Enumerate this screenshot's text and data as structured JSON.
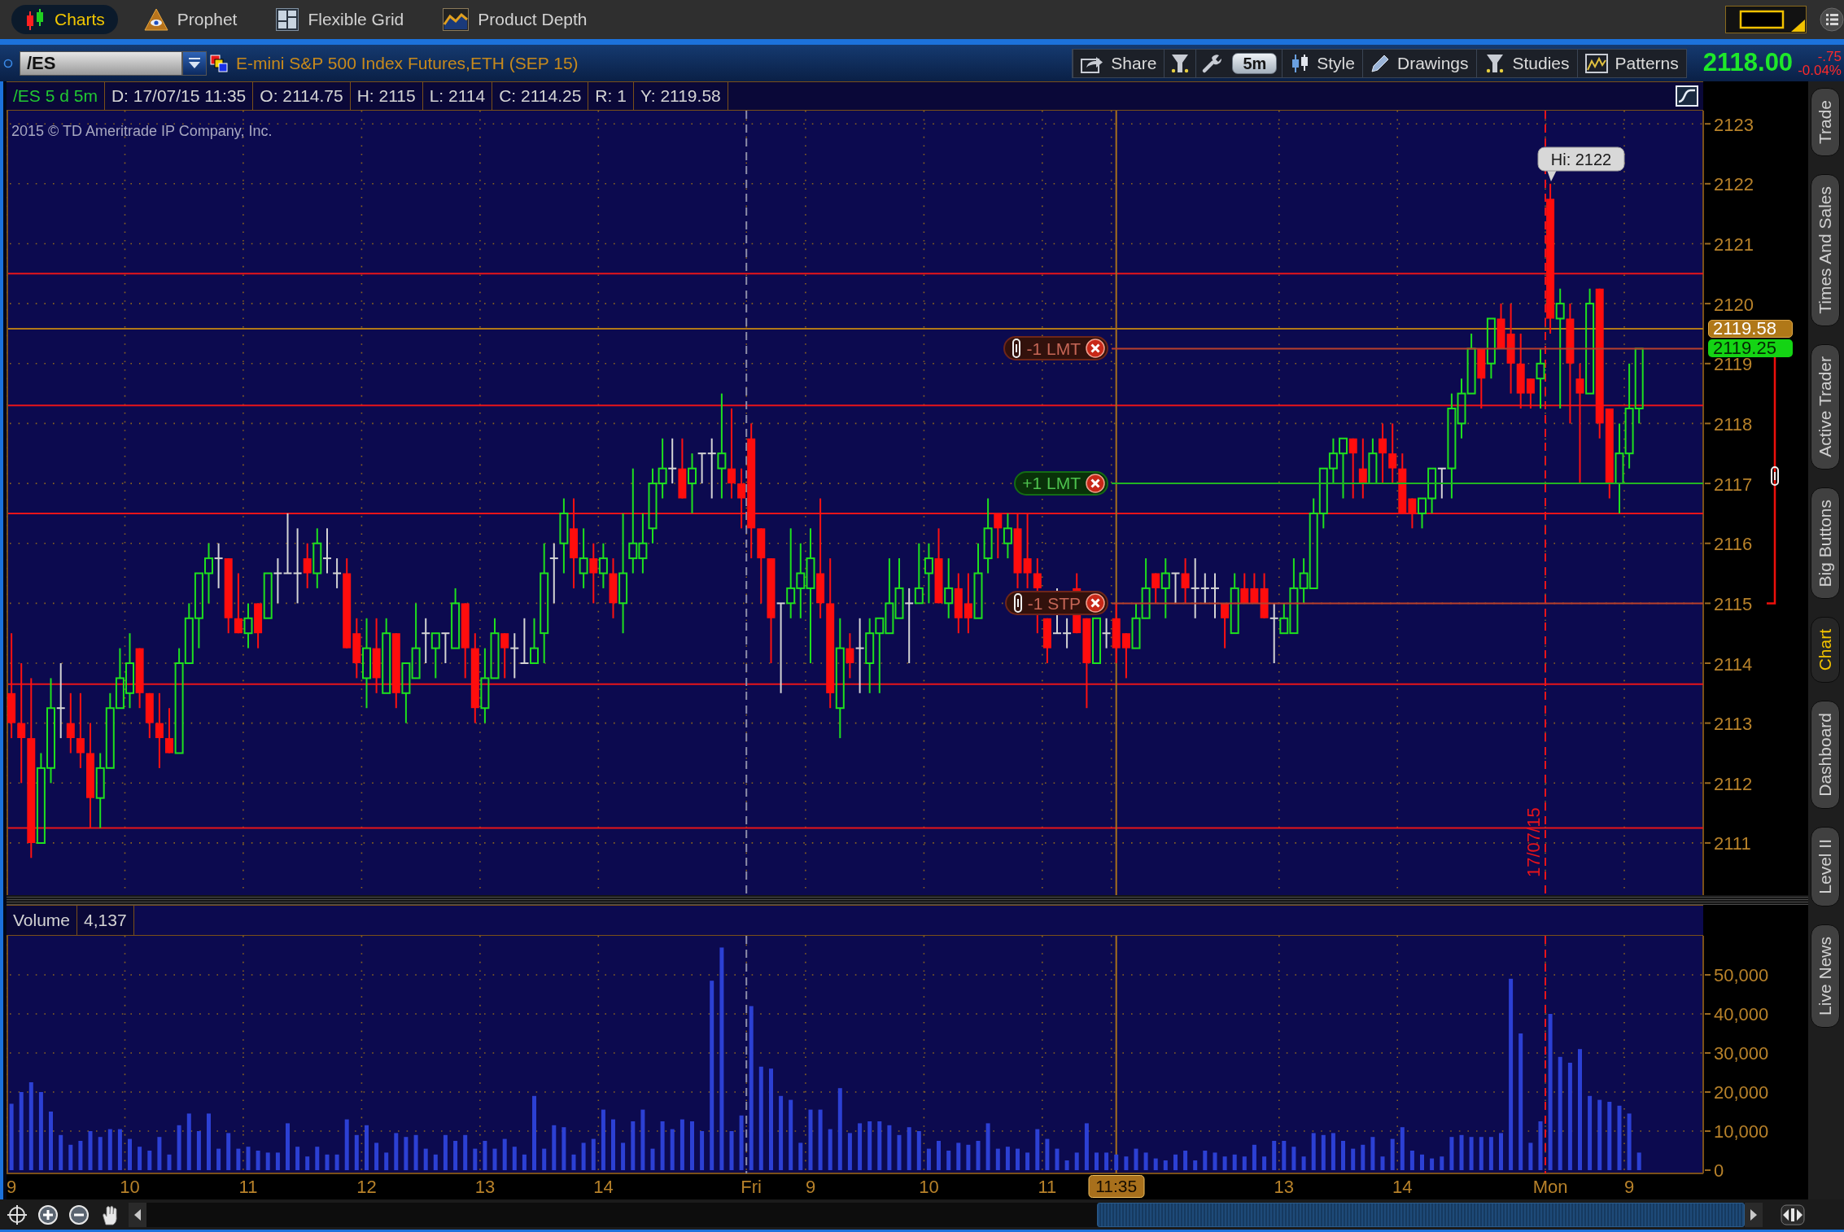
{
  "app_tabs": [
    {
      "label": "Charts",
      "selected": true
    },
    {
      "label": "Prophet",
      "selected": false
    },
    {
      "label": "Flexible Grid",
      "selected": false
    },
    {
      "label": "Product Depth",
      "selected": false
    }
  ],
  "chart_header": {
    "symbol": "/ES",
    "title": "E-mini S&P 500 Index Futures,ETH (SEP 15)",
    "toolbar": [
      {
        "kind": "button",
        "label": "Share"
      },
      {
        "kind": "icon"
      },
      {
        "kind": "icon"
      },
      {
        "kind": "pill",
        "label": "5m"
      },
      {
        "kind": "button",
        "label": "Style"
      },
      {
        "kind": "button",
        "label": "Drawings"
      },
      {
        "kind": "button",
        "label": "Studies"
      },
      {
        "kind": "button",
        "label": "Patterns"
      }
    ],
    "last_price": "2118.00",
    "change": "-.75",
    "change_percent": "-0.04%"
  },
  "info_bar": [
    {
      "kind": "symbol",
      "text": "/ES 5 d 5m"
    },
    {
      "kind": "value",
      "text": "D: 17/07/15 11:35"
    },
    {
      "kind": "value",
      "text": "O: 2114.75"
    },
    {
      "kind": "value",
      "text": "H: 2115"
    },
    {
      "kind": "value",
      "text": "L: 2114"
    },
    {
      "kind": "value",
      "text": "C: 2114.25"
    },
    {
      "kind": "value",
      "text": "R: 1"
    },
    {
      "kind": "value",
      "text": "Y: 2119.58"
    }
  ],
  "copyright": "2015 © TD Ameritrade IP Company, Inc.",
  "price_pane": {
    "chart_data": {
      "type": "candlestick",
      "tick_labels": "y",
      "grid": true,
      "ylim": [
        2110.13,
        2123.22
      ],
      "yticks": [
        2111,
        2112,
        2113,
        2114,
        2115,
        2116,
        2117,
        2118,
        2119,
        {
          "value": 2119.25,
          "label": "2119.25"
        },
        {
          "value": 2119.58,
          "label": "2119.58"
        },
        2120,
        2121,
        2122,
        2123
      ],
      "ohlc": [
        [
          2113.5,
          2114.5,
          2112.75,
          2113
        ],
        [
          2113,
          2114,
          2112,
          2112.75
        ],
        [
          2112.75,
          2113.75,
          2110.75,
          2111
        ],
        [
          2111,
          2112.5,
          2111,
          2112.25
        ],
        [
          2112.25,
          2113.75,
          2112,
          2113.25
        ],
        [
          2113.25,
          2114,
          2112.75,
          2113.25
        ],
        [
          2113,
          2113.5,
          2112.5,
          2112.75
        ],
        [
          2112.75,
          2113.5,
          2112.25,
          2112.5
        ],
        [
          2112.5,
          2113,
          2111.25,
          2111.75
        ],
        [
          2111.75,
          2112.5,
          2111.25,
          2112.25
        ],
        [
          2112.25,
          2113.5,
          2112.25,
          2113.25
        ],
        [
          2113.25,
          2114.25,
          2113.25,
          2113.75
        ],
        [
          2113.5,
          2114.5,
          2113.25,
          2114
        ],
        [
          2114.25,
          2114.25,
          2113.25,
          2113.5
        ],
        [
          2113.5,
          2113.5,
          2112.75,
          2113
        ],
        [
          2113,
          2113.5,
          2112.25,
          2112.75
        ],
        [
          2112.75,
          2113.25,
          2112.5,
          2112.5
        ],
        [
          2112.5,
          2114.25,
          2112.5,
          2114
        ],
        [
          2114,
          2115,
          2114,
          2114.75
        ],
        [
          2114.75,
          2115.5,
          2114.25,
          2115.5
        ],
        [
          2115.5,
          2116,
          2115,
          2115.75
        ],
        [
          2115.75,
          2116,
          2115.25,
          2115.75
        ],
        [
          2115.75,
          2115.75,
          2114.5,
          2114.75
        ],
        [
          2114.75,
          2115.5,
          2114.5,
          2114.5
        ],
        [
          2114.5,
          2115,
          2114.25,
          2114.75
        ],
        [
          2115,
          2115,
          2114.25,
          2114.5
        ],
        [
          2114.75,
          2115.5,
          2114.75,
          2115.5
        ],
        [
          2115.5,
          2115.75,
          2115,
          2115.5
        ],
        [
          2115.5,
          2116.5,
          2115.5,
          2115.5
        ],
        [
          2115.5,
          2116.25,
          2115,
          2115.5
        ],
        [
          2115.75,
          2116,
          2115.25,
          2115.5
        ],
        [
          2115.5,
          2116.25,
          2115.25,
          2116
        ],
        [
          2115.75,
          2116.25,
          2115.5,
          2115.75
        ],
        [
          2115.5,
          2115.75,
          2115.25,
          2115.5
        ],
        [
          2115.5,
          2115.75,
          2114.25,
          2114.25
        ],
        [
          2114.5,
          2114.75,
          2113.75,
          2114
        ],
        [
          2113.75,
          2114.75,
          2113.25,
          2114.25
        ],
        [
          2114.25,
          2114.75,
          2113.5,
          2113.75
        ],
        [
          2113.5,
          2114.75,
          2113.5,
          2114.5
        ],
        [
          2114.5,
          2114.5,
          2113.25,
          2113.5
        ],
        [
          2113.5,
          2114,
          2113,
          2114
        ],
        [
          2113.75,
          2115,
          2113.75,
          2114.25
        ],
        [
          2114.5,
          2114.75,
          2114,
          2114.5
        ],
        [
          2114.25,
          2114.5,
          2113.75,
          2114.5
        ],
        [
          2114.5,
          2114.5,
          2114,
          2114.5
        ],
        [
          2114.25,
          2115.25,
          2114.25,
          2115
        ],
        [
          2115,
          2115,
          2113.75,
          2114.25
        ],
        [
          2114.25,
          2114.5,
          2113,
          2113.25
        ],
        [
          2113.25,
          2114.25,
          2113,
          2113.75
        ],
        [
          2113.75,
          2114.75,
          2113.75,
          2114.5
        ],
        [
          2114.5,
          2114.5,
          2113.75,
          2114.25
        ],
        [
          2114.25,
          2114.5,
          2113.75,
          2114.25
        ],
        [
          2114,
          2114.75,
          2114,
          2114
        ],
        [
          2114,
          2114.75,
          2114,
          2114.25
        ],
        [
          2114.5,
          2116,
          2114,
          2115.5
        ],
        [
          2115.75,
          2116,
          2115,
          2115.75
        ],
        [
          2116,
          2116.75,
          2115.5,
          2116.5
        ],
        [
          2116.25,
          2116.75,
          2115.25,
          2115.75
        ],
        [
          2115.5,
          2116.25,
          2115.25,
          2115.75
        ],
        [
          2115.75,
          2116,
          2115,
          2115.5
        ],
        [
          2115.5,
          2116,
          2115.25,
          2115.75
        ],
        [
          2115.5,
          2115.75,
          2114.75,
          2115
        ],
        [
          2115,
          2116.5,
          2114.5,
          2115.5
        ],
        [
          2115.75,
          2117.25,
          2115.5,
          2116
        ],
        [
          2115.75,
          2116.5,
          2115.5,
          2116
        ],
        [
          2116.25,
          2117.25,
          2116,
          2117
        ],
        [
          2117,
          2117.75,
          2116.75,
          2117.25
        ],
        [
          2117.25,
          2117.75,
          2117,
          2117.25
        ],
        [
          2117.25,
          2117.75,
          2116.75,
          2116.75
        ],
        [
          2117,
          2117.5,
          2116.5,
          2117.25
        ],
        [
          2117.5,
          2117.5,
          2117,
          2117.5
        ],
        [
          2117.5,
          2117.75,
          2116.75,
          2117.5
        ],
        [
          2117.25,
          2118.5,
          2116.75,
          2117.5
        ],
        [
          2117.25,
          2118.25,
          2116.75,
          2117
        ],
        [
          2117,
          2117.25,
          2116.25,
          2116.75
        ],
        [
          2117.75,
          2118,
          2115.75,
          2116.25
        ],
        [
          2116.25,
          2116.25,
          2115,
          2115.75
        ],
        [
          2115.75,
          2115.75,
          2114,
          2114.75
        ],
        [
          2115,
          2115,
          2113.5,
          2115
        ],
        [
          2115,
          2116.25,
          2114.75,
          2115.25
        ],
        [
          2115.25,
          2116,
          2114.75,
          2115.5
        ],
        [
          2115.25,
          2116.25,
          2114,
          2115.75
        ],
        [
          2115.5,
          2116.75,
          2114.75,
          2115
        ],
        [
          2115,
          2115.75,
          2113.25,
          2113.5
        ],
        [
          2113.25,
          2114.75,
          2112.75,
          2114.25
        ],
        [
          2114.25,
          2114.5,
          2113.75,
          2114
        ],
        [
          2114.25,
          2114.75,
          2113.5,
          2114.25
        ],
        [
          2114,
          2114.75,
          2113.5,
          2114.5
        ],
        [
          2114.5,
          2114.75,
          2113.5,
          2114.75
        ],
        [
          2114.5,
          2115.75,
          2114.5,
          2115
        ],
        [
          2114.75,
          2115.75,
          2114.75,
          2115.25
        ],
        [
          2115,
          2115.25,
          2114,
          2115
        ],
        [
          2115,
          2116,
          2115,
          2115.25
        ],
        [
          2115.5,
          2116,
          2115,
          2115.75
        ],
        [
          2115.75,
          2116.25,
          2115,
          2115
        ],
        [
          2115,
          2115.75,
          2114.75,
          2115.25
        ],
        [
          2115.25,
          2115.5,
          2114.5,
          2114.75
        ],
        [
          2115,
          2115.5,
          2114.5,
          2114.75
        ],
        [
          2114.75,
          2116,
          2114.75,
          2115.5
        ],
        [
          2115.75,
          2116.75,
          2115.5,
          2116.25
        ],
        [
          2116.5,
          2116.5,
          2115.75,
          2116.25
        ],
        [
          2116,
          2116.5,
          2115.75,
          2116.25
        ],
        [
          2116.25,
          2116.5,
          2115.25,
          2115.5
        ],
        [
          2115.75,
          2116.5,
          2115.25,
          2115.5
        ],
        [
          2115.5,
          2115.75,
          2114.5,
          2115.25
        ],
        [
          2114.75,
          2114.75,
          2114,
          2114.25
        ],
        [
          2114.5,
          2115.25,
          2114.5,
          2114.5
        ],
        [
          2114.5,
          2114.75,
          2114.25,
          2114.5
        ],
        [
          2115.25,
          2115.5,
          2114.5,
          2114.5
        ],
        [
          2114.75,
          2114.75,
          2113.25,
          2114
        ],
        [
          2114,
          2114.75,
          2114,
          2114.75
        ],
        [
          2114.5,
          2114.75,
          2114.25,
          2114.5
        ],
        [
          2114.75,
          2115,
          2114,
          2114.25
        ],
        [
          2114.5,
          2114.5,
          2113.75,
          2114.25
        ],
        [
          2114.25,
          2115,
          2114.25,
          2114.75
        ],
        [
          2114.75,
          2115.75,
          2114.75,
          2115.25
        ],
        [
          2115.5,
          2115.5,
          2115,
          2115.25
        ],
        [
          2115.25,
          2115.75,
          2114.75,
          2115.5
        ],
        [
          2115.5,
          2115.5,
          2115,
          2115.5
        ],
        [
          2115.5,
          2115.75,
          2115,
          2115.25
        ],
        [
          2115.25,
          2115.75,
          2114.75,
          2115.25
        ],
        [
          2115.25,
          2115.5,
          2115,
          2115.25
        ],
        [
          2115.25,
          2115.5,
          2114.75,
          2115.25
        ],
        [
          2115,
          2115,
          2114.25,
          2114.75
        ],
        [
          2114.5,
          2115.5,
          2114.5,
          2115.25
        ],
        [
          2115.25,
          2115.5,
          2115,
          2115
        ],
        [
          2115.25,
          2115.5,
          2115,
          2115
        ],
        [
          2115.25,
          2115.5,
          2114.75,
          2114.75
        ],
        [
          2114.75,
          2115,
          2114,
          2114.75
        ],
        [
          2114.5,
          2115,
          2114.5,
          2114.75
        ],
        [
          2114.5,
          2115.75,
          2114.5,
          2115.25
        ],
        [
          2115.25,
          2115.75,
          2115,
          2115.5
        ],
        [
          2115.25,
          2116.75,
          2115.25,
          2116.5
        ],
        [
          2116.5,
          2117.25,
          2116.25,
          2117.25
        ],
        [
          2117.25,
          2117.75,
          2117,
          2117.5
        ],
        [
          2117.5,
          2117.75,
          2116.75,
          2117.75
        ],
        [
          2117.75,
          2117.75,
          2116.75,
          2117.5
        ],
        [
          2117.25,
          2117.75,
          2116.75,
          2117
        ],
        [
          2117,
          2117.75,
          2117,
          2117.5
        ],
        [
          2117.75,
          2118,
          2117,
          2117.5
        ],
        [
          2117.5,
          2118,
          2117,
          2117.25
        ],
        [
          2117.25,
          2117.5,
          2116.5,
          2116.5
        ],
        [
          2116.75,
          2116.75,
          2116.25,
          2116.5
        ],
        [
          2116.5,
          2116.75,
          2116.25,
          2116.75
        ],
        [
          2116.75,
          2117.25,
          2116.5,
          2117.25
        ],
        [
          2117.25,
          2117.25,
          2116.75,
          2117.25
        ],
        [
          2117.25,
          2118.5,
          2116.75,
          2118.25
        ],
        [
          2118,
          2118.75,
          2117.75,
          2118.5
        ],
        [
          2118.5,
          2119.5,
          2118.5,
          2119.25
        ],
        [
          2119.25,
          2119.25,
          2118.25,
          2118.75
        ],
        [
          2119,
          2119.75,
          2118.75,
          2119.75
        ],
        [
          2119.75,
          2120,
          2119.25,
          2119.25
        ],
        [
          2119.5,
          2120,
          2118.5,
          2119
        ],
        [
          2119,
          2119.5,
          2118.25,
          2118.5
        ],
        [
          2118.75,
          2118.75,
          2118.25,
          2118.5
        ],
        [
          2118.75,
          2119.25,
          2118.25,
          2119
        ],
        [
          2121.75,
          2122,
          2119.5,
          2119.75
        ],
        [
          2119.75,
          2120.25,
          2118.25,
          2120
        ],
        [
          2119.75,
          2120,
          2118,
          2119
        ],
        [
          2118.75,
          2119,
          2117,
          2118.5
        ],
        [
          2118.5,
          2120.25,
          2118.5,
          2120
        ],
        [
          2120.25,
          2120.25,
          2117.75,
          2118
        ],
        [
          2118.25,
          2118.25,
          2116.75,
          2117
        ],
        [
          2117,
          2118,
          2116.5,
          2117.5
        ],
        [
          2117.5,
          2119,
          2117.25,
          2118.25
        ],
        [
          2118.25,
          2119.25,
          2118,
          2119.25
        ],
        null,
        null,
        null,
        null,
        null,
        null
      ],
      "ref_lines": [
        {
          "axis": "y",
          "value": 2120.5,
          "color": "#e8141a"
        },
        {
          "axis": "y",
          "value": 2118.3,
          "color": "#e8141a"
        },
        {
          "axis": "y",
          "value": 2116.5,
          "color": "#e8141a"
        },
        {
          "axis": "y",
          "value": 2113.65,
          "color": "#e8141a"
        },
        {
          "axis": "y",
          "value": 2111.25,
          "color": "#e8141a"
        },
        {
          "axis": "y",
          "value": 2119.58,
          "color": "#b07818"
        },
        {
          "axis": "y",
          "value": 2119.25,
          "label": "-1 LMT",
          "color": "#b8402c"
        },
        {
          "axis": "y",
          "value": 2117,
          "label": "+1 LMT",
          "color": "#22b422"
        },
        {
          "axis": "y",
          "value": 2115,
          "label": "-1 STP",
          "color": "#b8402c"
        }
      ],
      "annotations": [
        "Hi: 2122",
        "17/07/15"
      ]
    }
  },
  "volume_pane": {
    "title": "Volume",
    "reading": "4,137",
    "chart_data": {
      "type": "bar",
      "color": "#2c40d4",
      "grid": true,
      "ylim": [
        0,
        60000
      ],
      "yticks": [
        {
          "value": 0,
          "label": "0"
        },
        {
          "value": 10000,
          "label": "10,000"
        },
        {
          "value": 20000,
          "label": "20,000"
        },
        {
          "value": 30000,
          "label": "30,000"
        },
        {
          "value": 40000,
          "label": "40,000"
        },
        {
          "value": 50000,
          "label": "50,000"
        }
      ],
      "categories": [
        "9",
        null,
        null,
        null,
        null,
        null,
        null,
        null,
        null,
        null,
        null,
        null,
        "10",
        null,
        null,
        null,
        null,
        null,
        null,
        null,
        null,
        null,
        null,
        null,
        "11",
        null,
        null,
        null,
        null,
        null,
        null,
        null,
        null,
        null,
        null,
        null,
        "12",
        null,
        null,
        null,
        null,
        null,
        null,
        null,
        null,
        null,
        null,
        null,
        "13",
        null,
        null,
        null,
        null,
        null,
        null,
        null,
        null,
        null,
        null,
        null,
        "14",
        null,
        null,
        null,
        null,
        null,
        null,
        null,
        null,
        null,
        null,
        null,
        null,
        null,
        null,
        "Fri",
        null,
        null,
        null,
        null,
        null,
        "9",
        null,
        null,
        null,
        null,
        null,
        null,
        null,
        null,
        null,
        null,
        null,
        "10",
        null,
        null,
        null,
        null,
        null,
        null,
        null,
        null,
        null,
        null,
        null,
        "11",
        null,
        null,
        null,
        null,
        null,
        null,
        "11:35",
        null,
        null,
        null,
        null,
        null,
        null,
        null,
        null,
        null,
        null,
        null,
        null,
        null,
        null,
        null,
        null,
        "13",
        null,
        null,
        null,
        null,
        null,
        null,
        null,
        null,
        null,
        null,
        null,
        "14",
        null,
        null,
        null,
        null,
        null,
        null,
        null,
        null,
        null,
        null,
        null,
        null,
        null,
        null,
        "Mon",
        null,
        null,
        null,
        null,
        null,
        null,
        null,
        "9",
        null,
        null,
        null,
        null,
        null,
        null,
        null
      ],
      "values": [
        17000,
        20000,
        22500,
        20000,
        15000,
        9000,
        6500,
        7500,
        10000,
        8500,
        10500,
        10500,
        8000,
        6000,
        5000,
        8500,
        4000,
        11500,
        14500,
        10000,
        14500,
        5500,
        9500,
        5500,
        6000,
        5000,
        4500,
        4500,
        12000,
        6000,
        3500,
        6000,
        4000,
        4000,
        13000,
        9000,
        11500,
        7000,
        4500,
        9500,
        8500,
        9000,
        5500,
        4000,
        9000,
        7500,
        9000,
        5500,
        7500,
        5500,
        8000,
        6000,
        4000,
        19000,
        5500,
        11500,
        11000,
        4000,
        7000,
        8000,
        15500,
        13000,
        7000,
        12500,
        15500,
        5500,
        12500,
        10500,
        13000,
        12500,
        10000,
        48500,
        57000,
        10000,
        14000,
        42000,
        26500,
        26000,
        19000,
        18000,
        7000,
        15500,
        15500,
        10500,
        21000,
        9500,
        12000,
        12500,
        12500,
        11500,
        9000,
        11000,
        10000,
        5500,
        7500,
        5000,
        7000,
        6500,
        7500,
        12000,
        5500,
        6000,
        5500,
        4500,
        10500,
        8000,
        5500,
        2500,
        4500,
        12000,
        4500,
        4500,
        4000,
        3500,
        5500,
        4500,
        3000,
        2500,
        4000,
        5000,
        2500,
        5000,
        4500,
        3500,
        4000,
        3500,
        6500,
        3500,
        7500,
        7500,
        6000,
        3500,
        9500,
        9000,
        9500,
        7500,
        5500,
        6500,
        8500,
        3500,
        8000,
        11000,
        5000,
        4000,
        3000,
        3500,
        8500,
        9000,
        8500,
        8500,
        8500,
        9500,
        49000,
        35000,
        7000,
        12500,
        40000,
        29000,
        27500,
        31000,
        19000,
        18000,
        17500,
        16500,
        14500,
        4500,
        null,
        null,
        null,
        null,
        null,
        null
      ],
      "ref_lines": [
        {
          "axis": "x",
          "value": "Fri",
          "color": "#8c8ca8",
          "line_style": "dashed"
        },
        {
          "axis": "x",
          "value": "Mon",
          "color": "#e8141a",
          "line_style": "dashed"
        },
        {
          "axis": "x",
          "value": "11:35",
          "color": "#a8701c"
        }
      ]
    }
  },
  "side_tabs": [
    {
      "label": "Trade",
      "selected": false
    },
    {
      "label": "Times And Sales",
      "selected": false
    },
    {
      "label": "Active Trader",
      "selected": false
    },
    {
      "label": "Big Buttons",
      "selected": false
    },
    {
      "label": "Chart",
      "selected": true
    },
    {
      "label": "Dashboard",
      "selected": false
    },
    {
      "label": "Level II",
      "selected": false
    },
    {
      "label": "Live News",
      "selected": false
    }
  ]
}
